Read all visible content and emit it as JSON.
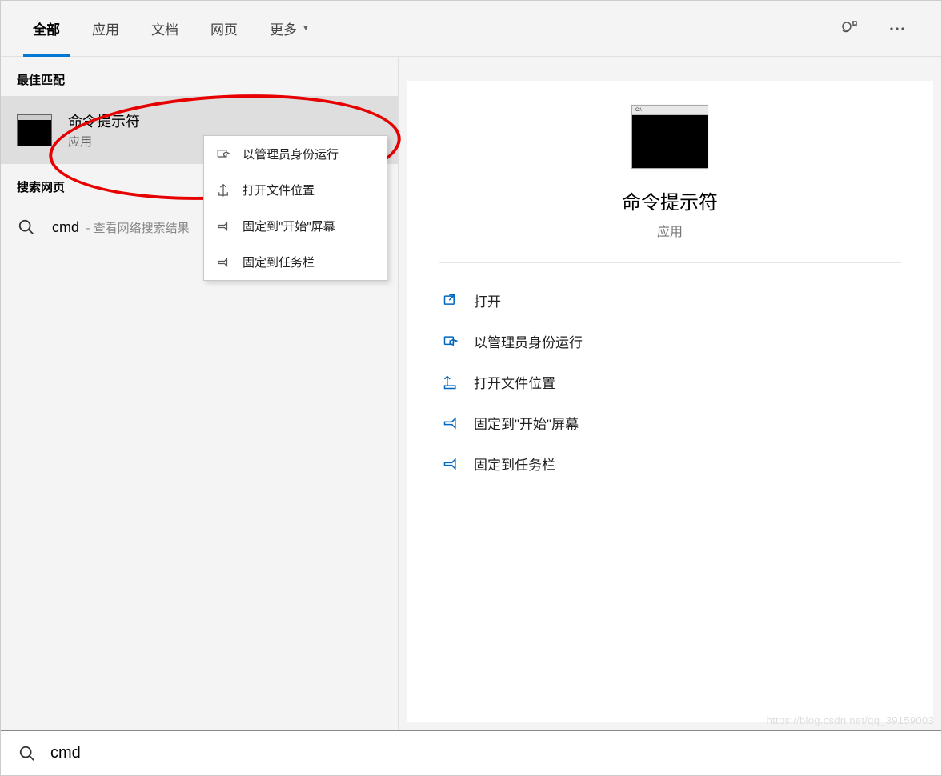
{
  "tabs": {
    "all": "全部",
    "apps": "应用",
    "docs": "文档",
    "web": "网页",
    "more": "更多"
  },
  "sections": {
    "best_match": "最佳匹配",
    "search_web": "搜索网页"
  },
  "result": {
    "title": "命令提示符",
    "subtitle": "应用"
  },
  "web_result": {
    "query": "cmd",
    "desc": "- 查看网络搜索结果"
  },
  "context_menu": {
    "run_admin": "以管理员身份运行",
    "open_location": "打开文件位置",
    "pin_start": "固定到\"开始\"屏幕",
    "pin_taskbar": "固定到任务栏"
  },
  "preview": {
    "title": "命令提示符",
    "subtitle": "应用",
    "bar_text": "C:\\"
  },
  "actions": {
    "open": "打开",
    "run_admin": "以管理员身份运行",
    "open_location": "打开文件位置",
    "pin_start": "固定到\"开始\"屏幕",
    "pin_taskbar": "固定到任务栏"
  },
  "search": {
    "value": "cmd"
  },
  "watermark": "https://blog.csdn.net/qq_39159003"
}
